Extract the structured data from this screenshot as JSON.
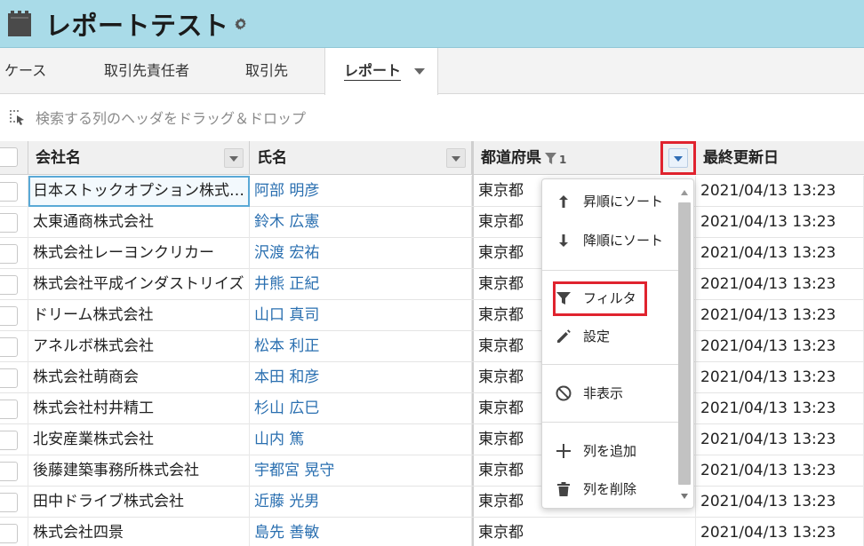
{
  "header": {
    "title": "レポートテスト"
  },
  "tabs": [
    {
      "label": "ケース"
    },
    {
      "label": "取引先責任者"
    },
    {
      "label": "取引先"
    },
    {
      "label": "レポート"
    }
  ],
  "groupby": {
    "placeholder": "検索する列のヘッダをドラッグ＆ドロップ"
  },
  "columns": {
    "company": "会社名",
    "name": "氏名",
    "prefecture": "都道府県",
    "prefecture_filter_count": "1",
    "updated": "最終更新日"
  },
  "rows": [
    {
      "company": "日本ストックオプション株式会社",
      "name": "阿部 明彦",
      "pref": "東京都",
      "updated": "2021/04/13 13:23"
    },
    {
      "company": "太東通商株式会社",
      "name": "鈴木 広憲",
      "pref": "東京都",
      "updated": "2021/04/13 13:23"
    },
    {
      "company": "株式会社レーヨンクリカー",
      "name": "沢渡 宏祐",
      "pref": "東京都",
      "updated": "2021/04/13 13:23"
    },
    {
      "company": "株式会社平成インダストリイズ",
      "name": "井熊 正紀",
      "pref": "東京都",
      "updated": "2021/04/13 13:23"
    },
    {
      "company": "ドリーム株式会社",
      "name": "山口 真司",
      "pref": "東京都",
      "updated": "2021/04/13 13:23"
    },
    {
      "company": "アネルボ株式会社",
      "name": "松本 利正",
      "pref": "東京都",
      "updated": "2021/04/13 13:23"
    },
    {
      "company": "株式会社萌商会",
      "name": "本田 和彦",
      "pref": "東京都",
      "updated": "2021/04/13 13:23"
    },
    {
      "company": "株式会社村井精工",
      "name": "杉山 広巳",
      "pref": "東京都",
      "updated": "2021/04/13 13:23"
    },
    {
      "company": "北安産業株式会社",
      "name": "山内 篤",
      "pref": "東京都",
      "updated": "2021/04/13 13:23"
    },
    {
      "company": "後藤建築事務所株式会社",
      "name": "宇都宮 晃守",
      "pref": "東京都",
      "updated": "2021/04/13 13:23"
    },
    {
      "company": "田中ドライブ株式会社",
      "name": "近藤 光男",
      "pref": "東京都",
      "updated": "2021/04/13 13:23"
    },
    {
      "company": "株式会社四景",
      "name": "島先 善敏",
      "pref": "東京都",
      "updated": "2021/04/13 13:23"
    }
  ],
  "menu": {
    "sort_asc": "昇順にソート",
    "sort_desc": "降順にソート",
    "filter": "フィルタ",
    "settings": "設定",
    "hide": "非表示",
    "add_column": "列を追加",
    "delete_column": "列を削除"
  },
  "colors": {
    "header_bg": "#a9dbe8",
    "highlight": "#e0232e",
    "link": "#2a6fb0"
  }
}
